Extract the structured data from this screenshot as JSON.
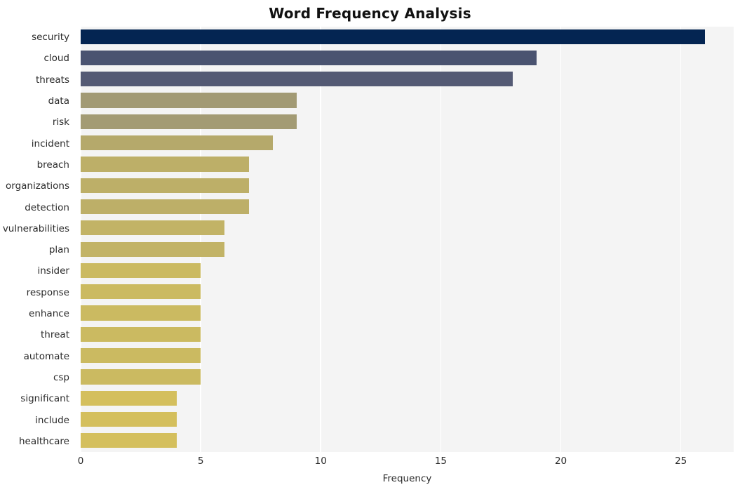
{
  "chart_data": {
    "type": "bar",
    "orientation": "horizontal",
    "title": "Word Frequency Analysis",
    "xlabel": "Frequency",
    "ylabel": "",
    "categories": [
      "security",
      "cloud",
      "threats",
      "data",
      "risk",
      "incident",
      "breach",
      "organizations",
      "detection",
      "vulnerabilities",
      "plan",
      "insider",
      "response",
      "enhance",
      "threat",
      "automate",
      "csp",
      "significant",
      "include",
      "healthcare"
    ],
    "values": [
      26,
      19,
      18,
      9,
      9,
      8,
      7,
      7,
      7,
      6,
      6,
      5,
      5,
      5,
      5,
      5,
      5,
      4,
      4,
      4
    ],
    "bar_colors": [
      "#042552",
      "#4a5370",
      "#545a74",
      "#a29a74",
      "#a39b74",
      "#b5a96b",
      "#bdaf68",
      "#bdaf68",
      "#bdaf68",
      "#c2b366",
      "#c2b366",
      "#cbba61",
      "#cbba61",
      "#cbba61",
      "#cbba61",
      "#cbba61",
      "#cbba61",
      "#d4bf5d",
      "#d4bf5d",
      "#d4bf5d"
    ],
    "xlim": [
      0,
      27.2
    ],
    "xticks": [
      0,
      5,
      10,
      15,
      20,
      25
    ],
    "xtick_labels": [
      "0",
      "5",
      "10",
      "15",
      "20",
      "25"
    ],
    "grid": "vertical-white",
    "legend": "none",
    "plot_background": "#f4f4f4",
    "figure_background": "#ffffff"
  }
}
